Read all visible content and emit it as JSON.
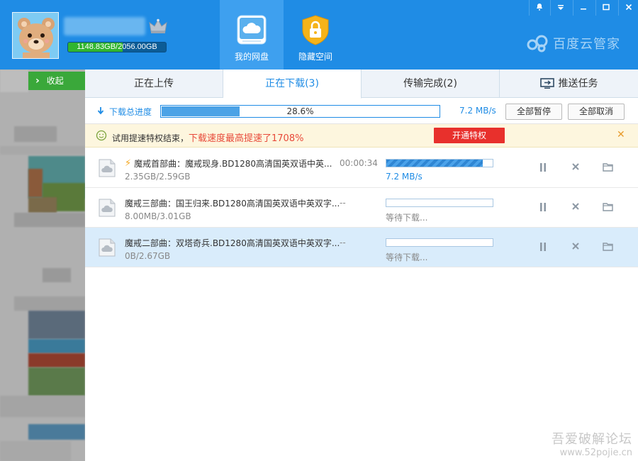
{
  "header": {
    "quota_text": "1148.83GB/2056.00GB",
    "quota_used_fraction": 0.5588,
    "nav": [
      {
        "label": "我的网盘",
        "icon": "cloud-icon",
        "active": true
      },
      {
        "label": "隐藏空间",
        "icon": "lock-icon",
        "active": false
      }
    ],
    "brand": "百度云管家",
    "window_controls": [
      "bell-icon",
      "dropdown-icon",
      "minimize-icon",
      "maximize-icon",
      "close-icon"
    ]
  },
  "sidebar": {
    "collapse_label": "收起"
  },
  "tabs": [
    {
      "label": "正在上传",
      "active": false
    },
    {
      "label": "正在下载(3)",
      "active": true
    },
    {
      "label": "传输完成(2)",
      "active": false
    },
    {
      "label": "推送任务",
      "active": false,
      "icon": "monitor-icon"
    }
  ],
  "total": {
    "label": "下载总进度",
    "percent_text": "28.6%",
    "percent": 28.6,
    "speed": "7.2 MB/s",
    "pause_all": "全部暂停",
    "cancel_all": "全部取消"
  },
  "notice": {
    "text": "试用提速特权结束，",
    "highlight": "下载速度最高提速了1708%",
    "button": "开通特权",
    "close": "✕"
  },
  "downloads": [
    {
      "name": "魔戒首部曲：魔戒现身.BD1280高清国英双语中英...",
      "size": "2.35GB/2.59GB",
      "eta": "00:00:34",
      "progress": 0.907,
      "status": "7.2 MB/s",
      "accelerated": true,
      "selected": false
    },
    {
      "name": "魔戒三部曲：国王归来.BD1280高清国英双语中英双字...",
      "size": "8.00MB/3.01GB",
      "eta": "--",
      "progress": 0.0,
      "status": "等待下载...",
      "accelerated": false,
      "selected": false
    },
    {
      "name": "魔戒二部曲：双塔奇兵.BD1280高清国英双语中英双字...",
      "size": "0B/2.67GB",
      "eta": "--",
      "progress": 0.0,
      "status": "等待下载...",
      "accelerated": false,
      "selected": true
    }
  ],
  "watermark": {
    "title": "吾爱破解论坛",
    "url": "www.52pojie.cn"
  },
  "colors": {
    "header_blue": "#1f8ce5",
    "accent_red": "#e84a3a",
    "progress_blue": "#4ba2e6",
    "green": "#3aa83a"
  }
}
